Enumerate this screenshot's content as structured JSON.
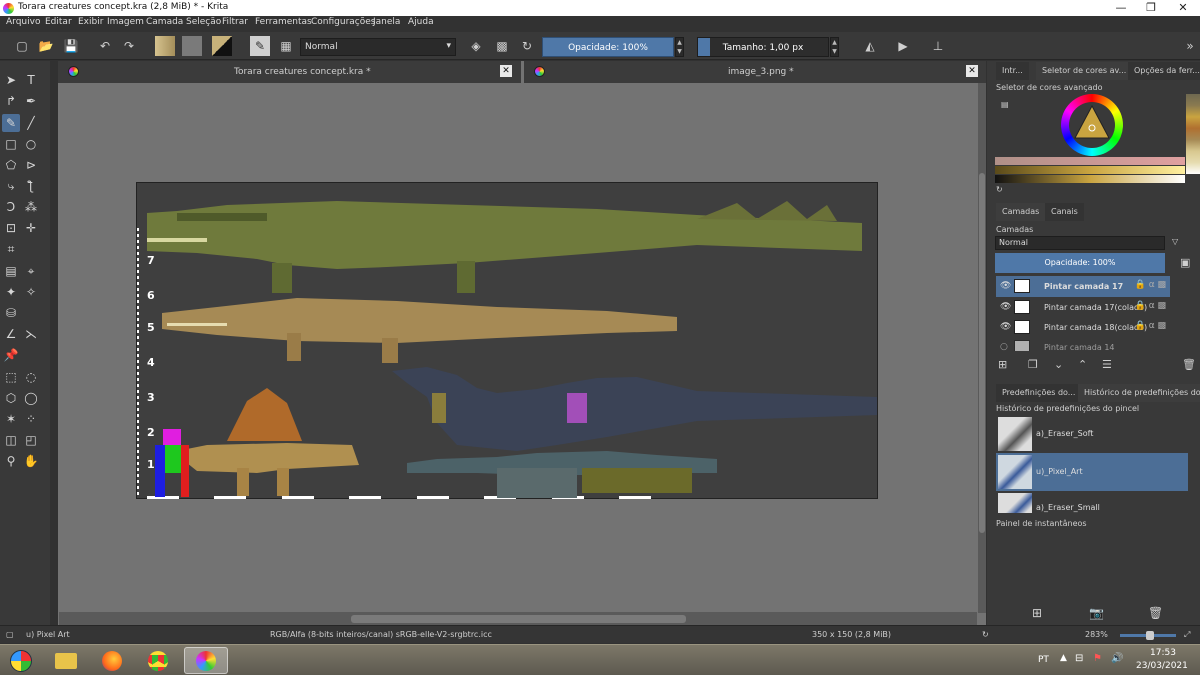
{
  "window": {
    "title": "Torara creatures concept.kra (2,8 MiB)  * - Krita"
  },
  "menu": [
    "Arquivo",
    "Editar",
    "Exibir",
    "Imagem",
    "Camada",
    "Seleção",
    "Filtrar",
    "Ferramentas",
    "Configurações",
    "Janela",
    "Ajuda"
  ],
  "toolbar": {
    "blend_mode": "Normal",
    "opacity_label": "Opacidade: 100%",
    "size_label": "Tamanho: 1,00 px"
  },
  "documents": [
    {
      "title": "Torara creatures concept.kra *"
    },
    {
      "title": "image_3.png *"
    }
  ],
  "canvas": {
    "ruler_numbers": [
      "7",
      "6",
      "5",
      "4",
      "3",
      "2",
      "1"
    ]
  },
  "right_panel": {
    "top_tabs": [
      "Intr...",
      "Seletor de cores av...",
      "Opções da ferr..."
    ],
    "color_selector_label": "Seletor de cores avançado",
    "layer_tabs": [
      "Camadas",
      "Canais"
    ],
    "layers_title": "Camadas",
    "blend_mode": "Normal",
    "opacity": "Opacidade:  100%",
    "layers": [
      {
        "name": "Pintar camada 17",
        "selected": true
      },
      {
        "name": "Pintar camada 17(colado)",
        "selected": false
      },
      {
        "name": "Pintar camada 18(colado)",
        "selected": false
      },
      {
        "name": "Pintar camada 14",
        "selected": false
      }
    ],
    "preset_tabs": [
      "Predefinições do...",
      "Histórico de predefinições do ..."
    ],
    "preset_history_title": "Histórico de predefinições do pincel",
    "presets": [
      {
        "name": "a)_Eraser_Soft"
      },
      {
        "name": "u)_Pixel_Art"
      },
      {
        "name": "a)_Eraser_Small"
      }
    ],
    "snapshot_title": "Painel de instantâneos"
  },
  "status": {
    "brush": "u) Pixel Art",
    "color_profile": "RGB/Alfa (8-bits inteiros/canal)  sRGB-elle-V2-srgbtrc.icc",
    "dimensions": "350 x 150 (2,8 MiB)",
    "zoom": "283%"
  },
  "taskbar": {
    "language": "PT",
    "time": "17:53",
    "date": "23/03/2021"
  },
  "colors": {
    "accent": "#4c6e96",
    "canvas_bg": "#3f3f3f",
    "doc_bg": "#737373"
  }
}
